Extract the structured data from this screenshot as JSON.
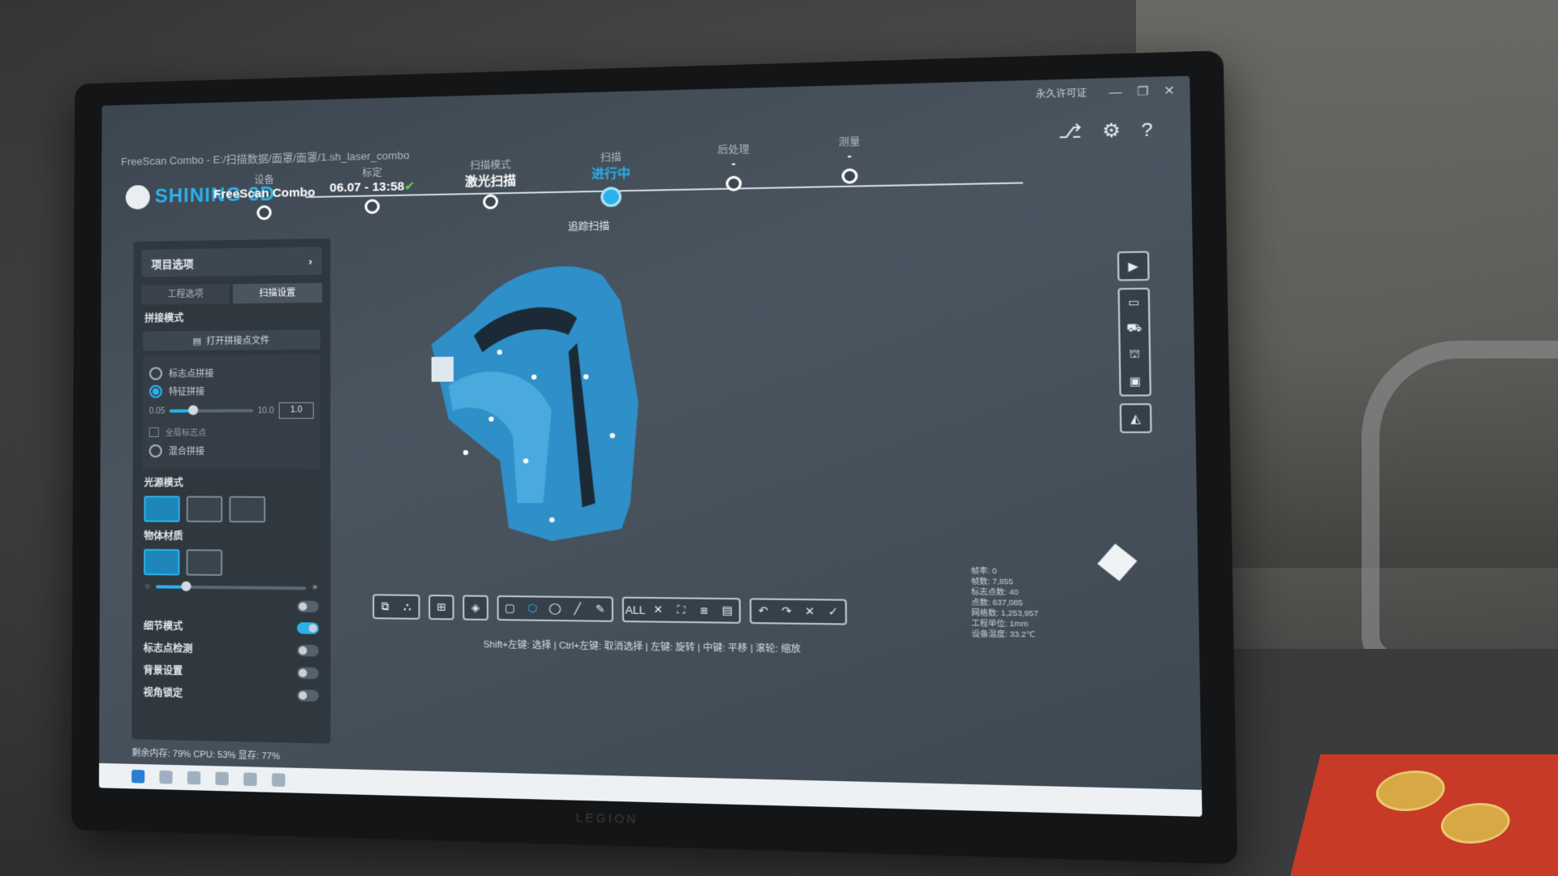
{
  "window": {
    "title_path": "FreeScan Combo - E:/扫描数据/面罩/面罩/1.sh_laser_combo",
    "license": "永久许可证",
    "controls": [
      "—",
      "❐",
      "✕"
    ]
  },
  "brand": {
    "logo": "SHINING 3D",
    "device_label": "LEGION"
  },
  "steps": [
    {
      "label": "设备",
      "value": "FreeScan Combo",
      "active": false
    },
    {
      "label": "标定",
      "value": "06.07 - 13:58",
      "check": "✔",
      "active": false
    },
    {
      "label": "扫描模式",
      "value": "激光扫描",
      "active": false
    },
    {
      "label": "扫描",
      "value": "进行中",
      "active": true
    },
    {
      "label": "后处理",
      "value": "-",
      "active": false
    },
    {
      "label": "测量",
      "value": "-",
      "active": false
    }
  ],
  "top_icons": [
    "share-icon",
    "gear-icon",
    "help-icon"
  ],
  "scan_mode_title": "追踪扫描",
  "left_panel": {
    "header": "项目选项",
    "tabs": [
      "工程选项",
      "扫描设置"
    ],
    "section_align": "拼接模式",
    "open_file_button": "打开拼接点文件",
    "radios": [
      "标志点拼接",
      "特征拼接"
    ],
    "slider": {
      "min": "0.05",
      "max": "10.0",
      "value": "1.0",
      "fill": 0.28
    },
    "checkbox_label": "全局标志点",
    "radio_extra": "混合拼接",
    "section_light": "光源模式",
    "section_object": "物体材质",
    "brightness_fill": 0.2,
    "toggles": [
      {
        "label": "",
        "on": false
      },
      {
        "label": "细节模式",
        "on": true
      },
      {
        "label": "标志点检测",
        "on": false
      },
      {
        "label": "背景设置",
        "on": false
      },
      {
        "label": "视角锁定",
        "on": false
      }
    ]
  },
  "statusbar": "剩余内存: 79%  CPU: 53%  显存: 77%",
  "bottom_hint": "Shift+左键: 选择 | Ctrl+左键: 取消选择 | 左键: 旋转 | 中键: 平移 | 滚轮: 缩放",
  "bottom_tools": {
    "group1": [
      "⧉",
      "⛬"
    ],
    "group2": [
      "⊞"
    ],
    "group3": [
      "◈"
    ],
    "group4": [
      "▢",
      "⬡",
      "◯",
      "╱",
      "✎"
    ],
    "group5": [
      "ALL",
      "✕",
      "⛶",
      "⧈",
      "▤"
    ],
    "group6": [
      "↶",
      "↷",
      "✕",
      "✓"
    ]
  },
  "right_tools": {
    "top": "▶",
    "group": [
      "▭",
      "⛟",
      "⛫",
      "▣"
    ],
    "bottom": "◭"
  },
  "stats": [
    "帧率: 0",
    "帧数: 7,855",
    "标志点数: 40",
    "点数: 637,085",
    "网格数: 1,253,957",
    "工程单位: 1mm",
    "设备温度: 33.2℃"
  ],
  "colors": {
    "accent": "#2ab1ea",
    "model": "#2f8fc8"
  }
}
